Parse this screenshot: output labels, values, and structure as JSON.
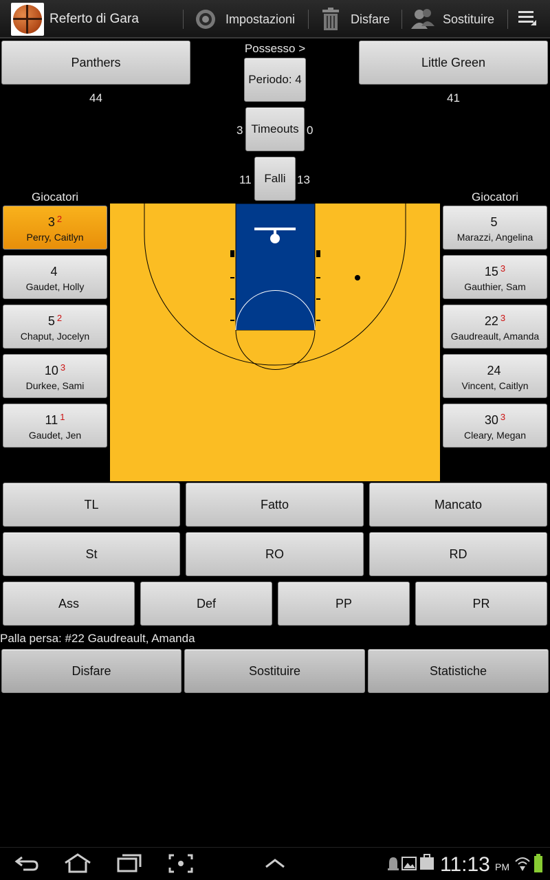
{
  "app": {
    "title": "Referto di Gara",
    "actions": {
      "settings": "Impostazioni",
      "undo": "Disfare",
      "substitute": "Sostituire"
    }
  },
  "teams": {
    "home": {
      "name": "Panthers",
      "score": "44"
    },
    "away": {
      "name": "Little Green",
      "score": "41"
    }
  },
  "possession_label": "Possesso >",
  "period_label": "Periodo: 4",
  "timeouts": {
    "label": "Timeouts",
    "home": "3",
    "away": "0"
  },
  "fouls": {
    "label": "Falli",
    "home": "11",
    "away": "13"
  },
  "players_label": "Giocatori",
  "home_players": [
    {
      "number": "3",
      "fouls": "2",
      "name": "Perry, Caitlyn",
      "selected": true
    },
    {
      "number": "4",
      "fouls": "",
      "name": "Gaudet, Holly"
    },
    {
      "number": "5",
      "fouls": "2",
      "name": "Chaput, Jocelyn"
    },
    {
      "number": "10",
      "fouls": "3",
      "name": "Durkee, Sami"
    },
    {
      "number": "11",
      "fouls": "1",
      "name": "Gaudet, Jen"
    }
  ],
  "away_players": [
    {
      "number": "5",
      "fouls": "",
      "name": "Marazzi, Angelina"
    },
    {
      "number": "15",
      "fouls": "3",
      "name": "Gauthier, Sam"
    },
    {
      "number": "22",
      "fouls": "3",
      "name": "Gaudreault, Amanda"
    },
    {
      "number": "24",
      "fouls": "",
      "name": "Vincent, Caitlyn"
    },
    {
      "number": "30",
      "fouls": "3",
      "name": "Cleary, Megan"
    }
  ],
  "stat_buttons": {
    "row1": [
      "TL",
      "Fatto",
      "Mancato"
    ],
    "row2": [
      "St",
      "RO",
      "RD"
    ],
    "row3": [
      "Ass",
      "Def",
      "PP",
      "PR"
    ]
  },
  "status_text": "Palla persa: #22 Gaudreault, Amanda",
  "bottom_buttons": [
    "Disfare",
    "Sostituire",
    "Statistiche"
  ],
  "colors": {
    "court": "#fbbd23",
    "paint": "#003a8c",
    "selected": "#f5a312"
  },
  "system": {
    "time": "11:13",
    "ampm": "PM"
  }
}
